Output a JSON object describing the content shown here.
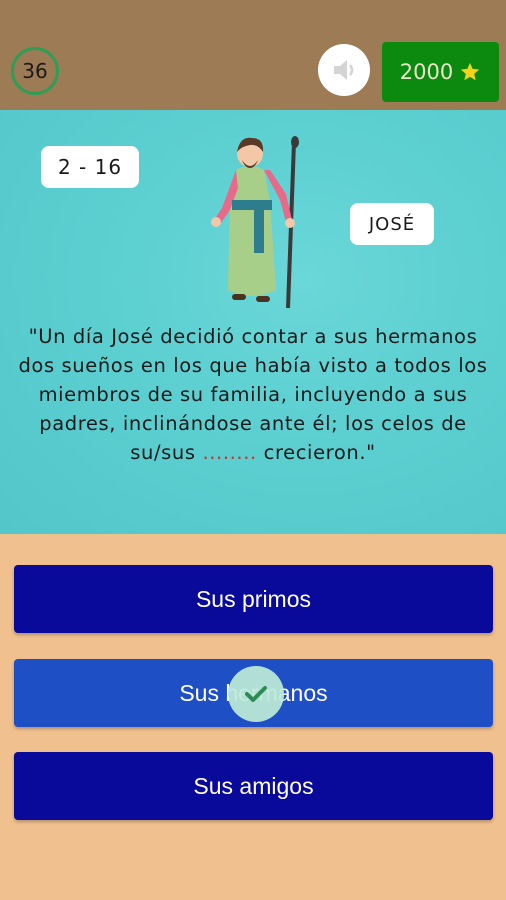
{
  "header": {
    "timer": "36",
    "coins": "2000",
    "sound_icon": "speaker-icon",
    "coin_icon": "star-icon"
  },
  "question": {
    "level": "2 - 16",
    "character": "JOSÉ",
    "text_before": "\"Un día José decidió contar a sus hermanos dos sueños en los que había visto a todos los miembros de su familia, incluyendo a sus padres, inclinándose ante él; los celos de su/sus ",
    "blank": "........",
    "text_after": " crecieron.\""
  },
  "answers": [
    {
      "label": "Sus primos"
    },
    {
      "label": "Sus hermanos"
    },
    {
      "label": "Sus amigos"
    }
  ],
  "colors": {
    "header_bg": "#9c7b55",
    "scene_bg": "#5ccfd1",
    "answer_bg": "#0a0a9a",
    "answer_selected_bg": "#1f4fc5",
    "coins_bg": "#0c8a10",
    "timer_ring": "#2e9e55"
  }
}
